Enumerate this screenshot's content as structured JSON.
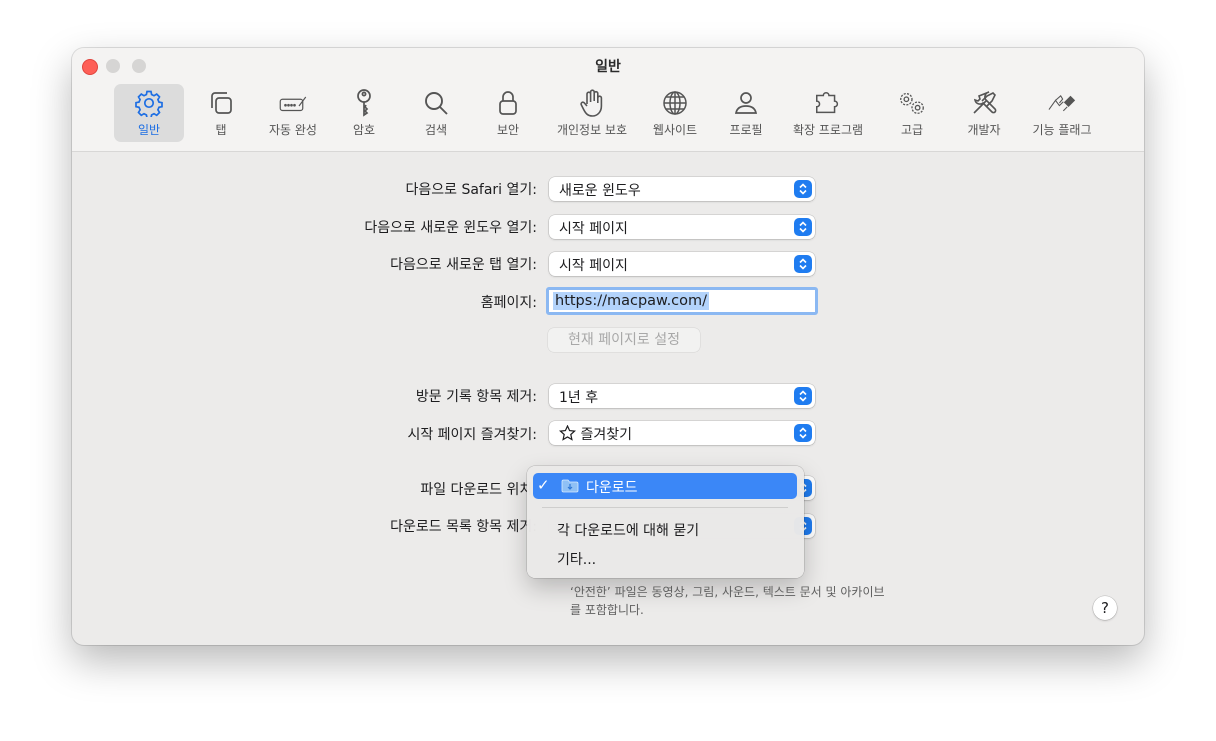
{
  "window": {
    "title": "일반"
  },
  "toolbar": {
    "items": [
      {
        "label": "일반",
        "icon": "gear-icon",
        "active": true
      },
      {
        "label": "탭",
        "icon": "tabs-icon"
      },
      {
        "label": "자동 완성",
        "icon": "autofill-icon"
      },
      {
        "label": "암호",
        "icon": "key-icon"
      },
      {
        "label": "검색",
        "icon": "search-icon"
      },
      {
        "label": "보안",
        "icon": "lock-icon"
      },
      {
        "label": "개인정보 보호",
        "icon": "hand-icon"
      },
      {
        "label": "웹사이트",
        "icon": "globe-icon"
      },
      {
        "label": "프로필",
        "icon": "person-icon"
      },
      {
        "label": "확장 프로그램",
        "icon": "puzzle-icon"
      },
      {
        "label": "고급",
        "icon": "gears-icon"
      },
      {
        "label": "개발자",
        "icon": "tools-icon"
      },
      {
        "label": "기능 플래그",
        "icon": "flags-icon"
      }
    ]
  },
  "settings": {
    "safari_opens_with": {
      "label": "다음으로 Safari 열기:",
      "value": "새로운 윈도우"
    },
    "new_windows_open_with": {
      "label": "다음으로 새로운 윈도우 열기:",
      "value": "시작 페이지"
    },
    "new_tabs_open_with": {
      "label": "다음으로 새로운 탭 열기:",
      "value": "시작 페이지"
    },
    "homepage": {
      "label": "홈페이지:",
      "value": "https://macpaw.com/"
    },
    "set_current_page_button": "현재 페이지로 설정",
    "remove_history": {
      "label": "방문 기록 항목 제거:",
      "value": "1년 후"
    },
    "favorites_shows": {
      "label": "시작 페이지 즐겨찾기:",
      "value": "즐겨찾기",
      "icon": "star-icon"
    },
    "download_location": {
      "label": "파일 다운로드 위치:"
    },
    "remove_download_list": {
      "label": "다운로드 목록 항목 제거:"
    },
    "footnote": "‘안전한’ 파일은 동영상, 그림, 사운드, 텍스트 문서 및 아카이브를 포함합니다."
  },
  "download_menu": {
    "selected": "다운로드",
    "checkmark": "✓",
    "items": [
      "각 다운로드에 대해 묻기",
      "기타..."
    ]
  },
  "help_label": "?",
  "colors": {
    "accent": "#1f7cf0",
    "menu_highlight": "#3b87f7",
    "close": "#fe5f57"
  }
}
